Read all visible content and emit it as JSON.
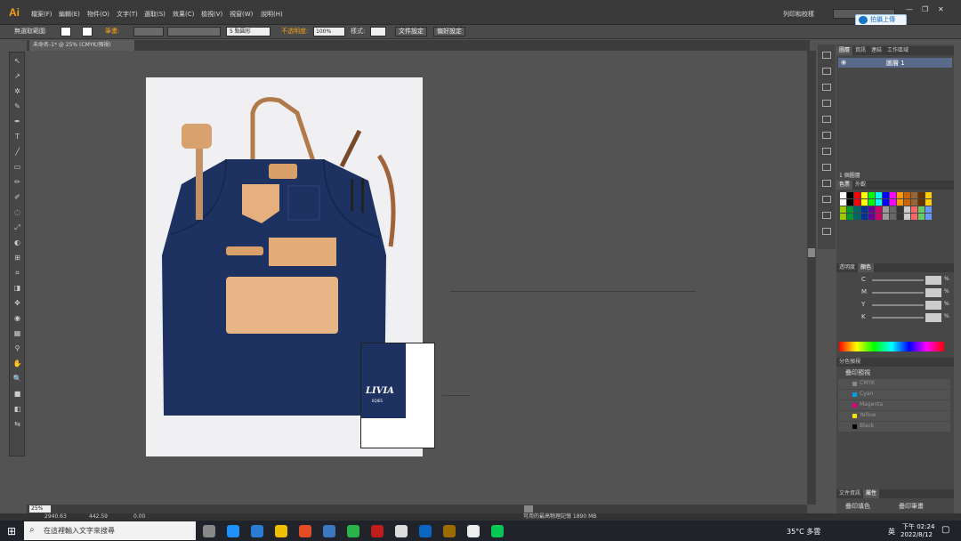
{
  "app": {
    "logo": "Ai"
  },
  "menu": [
    "檔案(F)",
    "編輯(E)",
    "物件(O)",
    "文字(T)",
    "選取(S)",
    "效果(C)",
    "檢視(V)",
    "視窗(W)",
    "說明(H)"
  ],
  "workspace": {
    "label": "列印和校樣",
    "search_placeholder": "Ps"
  },
  "cloud_button": "拍攝上傳",
  "control": {
    "no_selection": "無選取範圍",
    "stroke_label": "筆畫:",
    "brush": "5 點圓形",
    "opacity_label": "不透明度:",
    "opacity_value": "100%",
    "style_label": "樣式:",
    "doc_setup": "文件設定",
    "prefs": "偏好設定"
  },
  "doc_tab": "未命名-1* @ 25% (CMYK/預視)",
  "layers": {
    "tabs": [
      "圖層",
      "資訊",
      "連結",
      "工作區域"
    ],
    "layer_name": "圖層 1",
    "count": "1 個圖層"
  },
  "swatches": {
    "tabs": [
      "色票",
      "外觀"
    ],
    "colors": [
      "#ffffff",
      "#000000",
      "#ff0000",
      "#ffff00",
      "#00ff00",
      "#00ffff",
      "#0000ff",
      "#ff00ff",
      "#ff9900",
      "#cc6600",
      "#996633",
      "#663300",
      "#ffcc00",
      "#99cc00",
      "#009933",
      "#006666",
      "#003399",
      "#660099",
      "#cc0066",
      "#999999",
      "#666666",
      "#333333",
      "#cccccc",
      "#ff6666",
      "#66cc66",
      "#6699ff"
    ]
  },
  "color": {
    "tabs": [
      "透明度",
      "顏色"
    ],
    "labels": [
      "C",
      "M",
      "Y",
      "K"
    ],
    "pct": "%"
  },
  "separations": {
    "title": "分色預視",
    "overprint": "疊印預視",
    "items": [
      {
        "name": "CMYK",
        "color": "#888888"
      },
      {
        "name": "Cyan",
        "color": "#00a0e0"
      },
      {
        "name": "Magenta",
        "color": "#e0007a"
      },
      {
        "name": "Yellow",
        "color": "#f2e400"
      },
      {
        "name": "Black",
        "color": "#000000"
      }
    ]
  },
  "bottom_panel": {
    "tabs": [
      "文件資訊",
      "屬性"
    ],
    "fill": "疊印填色",
    "stroke": "疊印筆畫"
  },
  "zoom": "25%",
  "artwork": {
    "brand": "LIVIA",
    "sub": "EQIES"
  },
  "status": {
    "x": "2940.63",
    "y": "442.59",
    "z": "0.00",
    "info": "可用的最高物理記憶 1890 MB"
  },
  "taskbar": {
    "search": "在這裡輸入文字來搜尋",
    "temp": "35°C 多雲",
    "ime": "英",
    "time": "下午 02:24",
    "date": "2022/8/12"
  }
}
